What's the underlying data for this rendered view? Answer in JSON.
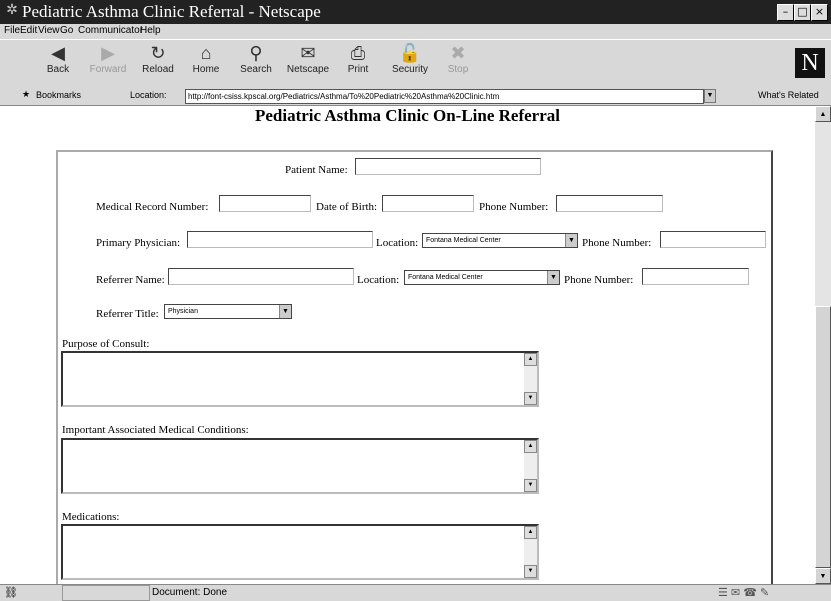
{
  "window": {
    "title": "Pediatric Asthma Clinic Referral - Netscape"
  },
  "menu": [
    "File",
    "Edit",
    "View",
    "Go",
    "Communicator",
    "Help"
  ],
  "toolbar": [
    "Back",
    "Forward",
    "Reload",
    "Home",
    "Search",
    "Netscape",
    "Print",
    "Security",
    "Stop"
  ],
  "locationbar": {
    "bookmarks": "Bookmarks",
    "location_label": "Location:",
    "url": "http://font-csiss.kpscal.org/Pediatrics/Asthma/To%20Pediatric%20Asthma%20Clinic.htm",
    "whats_related": "What's Related"
  },
  "page": {
    "title": "Pediatric Asthma Clinic On-Line Referral",
    "patient_name": "Patient Name:",
    "mrn": "Medical Record Number:",
    "dob": "Date of Birth:",
    "phone": "Phone Number:",
    "primary_physician": "Primary Physician:",
    "location": "Location:",
    "location_value": "Fontana Medical Center",
    "referrer_name": "Referrer Name:",
    "referrer_title": "Referrer Title:",
    "referrer_title_value": "Physician",
    "purpose": "Purpose of Consult:",
    "conditions": "Important Associated Medical Conditions:",
    "medications": "Medications:"
  },
  "status": {
    "text": "Document: Done"
  }
}
